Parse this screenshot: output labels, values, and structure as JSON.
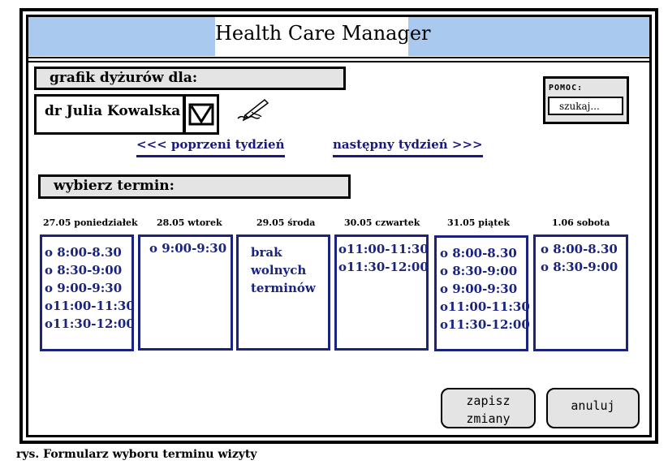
{
  "header": {
    "title": "Health Care Manager"
  },
  "schedule": {
    "label": "grafik dyżurów dla:",
    "doctor": "dr Julia Kowalska"
  },
  "help": {
    "label": "POMOC:",
    "search_placeholder": "szukaj..."
  },
  "nav": {
    "prev_week": "<<< poprzeni tydzień",
    "next_week": "następny tydzień >>>"
  },
  "choose_label": "wybierz termin:",
  "days": [
    {
      "header": "27.05 poniedziałek",
      "slots": [
        "o 8:00-8.30",
        "o 8:30-9:00",
        "o 9:00-9:30",
        "o11:00-11:30",
        "o11:30-12:00"
      ]
    },
    {
      "header": "28.05 wtorek",
      "slots": [
        "o 9:00-9:30"
      ]
    },
    {
      "header": "29.05 środa",
      "no_slots": "brak\nwolnych\nterminów"
    },
    {
      "header": "30.05 czwartek",
      "slots": [
        "o11:00-11:30",
        "o11:30-12:00"
      ]
    },
    {
      "header": "31.05 piątek",
      "slots": [
        "o 8:00-8.30",
        "o 8:30-9:00",
        "o 9:00-9:30",
        "o11:00-11:30",
        "o11:30-12:00"
      ]
    },
    {
      "header": "1.06 sobota",
      "slots": [
        "o 8:00-8.30",
        "o 8:30-9:00"
      ]
    }
  ],
  "buttons": {
    "save": "zapisz\nzmiany",
    "cancel": "anuluj"
  },
  "caption": "rys. Formularz wyboru terminu wizyty",
  "colors": {
    "title_bar": "#a9c9ee",
    "label_bg": "#e4e4e4",
    "link": "#1a1a7e",
    "slot": "#1a237e"
  }
}
